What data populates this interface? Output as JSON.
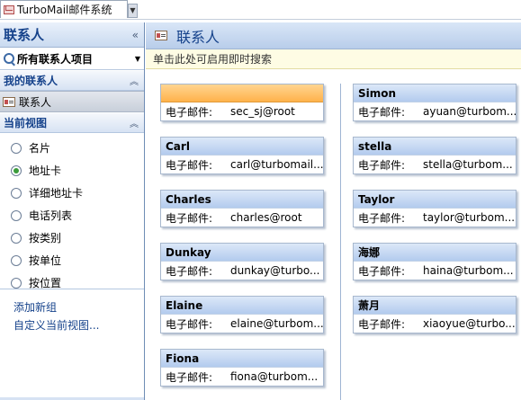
{
  "app": {
    "tab_title": "TurboMail邮件系统",
    "tab_menu_icon": "chevron-down-icon"
  },
  "sidebar": {
    "title": "联系人",
    "collapse_glyph": "«",
    "scope_label": "所有联系人项目",
    "my_contacts_title": "我的联系人",
    "folder_label": "联系人",
    "current_view_title": "当前视图",
    "views": [
      {
        "label": "名片",
        "selected": false
      },
      {
        "label": "地址卡",
        "selected": true
      },
      {
        "label": "详细地址卡",
        "selected": false
      },
      {
        "label": "电话列表",
        "selected": false
      },
      {
        "label": "按类别",
        "selected": false
      },
      {
        "label": "按单位",
        "selected": false
      },
      {
        "label": "按位置",
        "selected": false
      }
    ],
    "links": [
      "添加新组",
      "自定义当前视图..."
    ]
  },
  "main": {
    "title": "联系人",
    "search_hint": "单击此处可启用即时搜索",
    "email_label": "电子邮件:",
    "left_column": [
      {
        "name": "",
        "email": "sec_sj@root",
        "selected": true
      },
      {
        "name": "Carl",
        "email": "carl@turbomail...",
        "selected": false
      },
      {
        "name": "Charles",
        "email": "charles@root",
        "selected": false
      },
      {
        "name": "Dunkay",
        "email": "dunkay@turbo...",
        "selected": false
      },
      {
        "name": "Elaine",
        "email": "elaine@turbom...",
        "selected": false
      },
      {
        "name": "Fiona",
        "email": "fiona@turbom...",
        "selected": false
      }
    ],
    "right_column": [
      {
        "name": "Simon",
        "email": "ayuan@turbom...",
        "selected": false
      },
      {
        "name": "stella",
        "email": "stella@turbom...",
        "selected": false
      },
      {
        "name": "Taylor",
        "email": "taylor@turbom...",
        "selected": false
      },
      {
        "name": "海娜",
        "email": "haina@turbom...",
        "selected": false
      },
      {
        "name": "萧月",
        "email": "xiaoyue@turbo...",
        "selected": false
      }
    ]
  }
}
